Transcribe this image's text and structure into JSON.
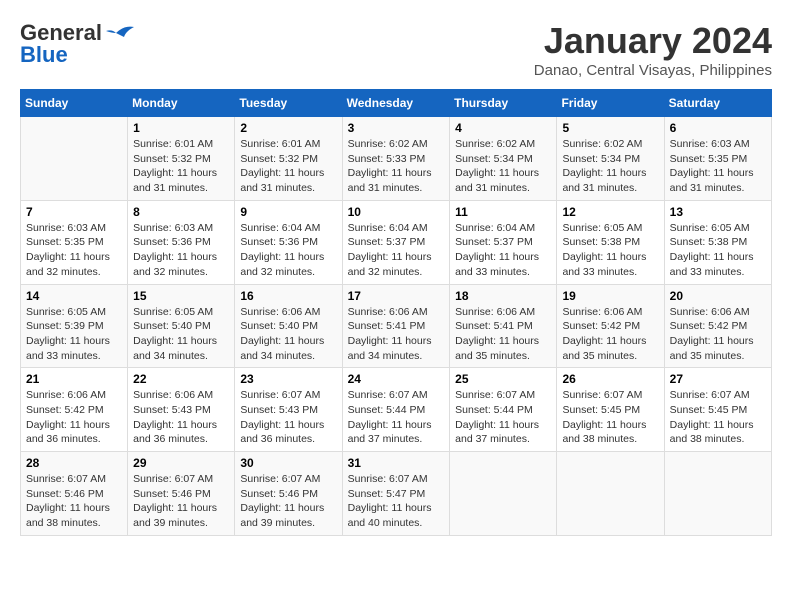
{
  "header": {
    "logo_general": "General",
    "logo_blue": "Blue",
    "month_title": "January 2024",
    "location": "Danao, Central Visayas, Philippines"
  },
  "days_of_week": [
    "Sunday",
    "Monday",
    "Tuesday",
    "Wednesday",
    "Thursday",
    "Friday",
    "Saturday"
  ],
  "weeks": [
    [
      {
        "day": "",
        "sunrise": "",
        "sunset": "",
        "daylight": ""
      },
      {
        "day": "1",
        "sunrise": "Sunrise: 6:01 AM",
        "sunset": "Sunset: 5:32 PM",
        "daylight": "Daylight: 11 hours and 31 minutes."
      },
      {
        "day": "2",
        "sunrise": "Sunrise: 6:01 AM",
        "sunset": "Sunset: 5:32 PM",
        "daylight": "Daylight: 11 hours and 31 minutes."
      },
      {
        "day": "3",
        "sunrise": "Sunrise: 6:02 AM",
        "sunset": "Sunset: 5:33 PM",
        "daylight": "Daylight: 11 hours and 31 minutes."
      },
      {
        "day": "4",
        "sunrise": "Sunrise: 6:02 AM",
        "sunset": "Sunset: 5:34 PM",
        "daylight": "Daylight: 11 hours and 31 minutes."
      },
      {
        "day": "5",
        "sunrise": "Sunrise: 6:02 AM",
        "sunset": "Sunset: 5:34 PM",
        "daylight": "Daylight: 11 hours and 31 minutes."
      },
      {
        "day": "6",
        "sunrise": "Sunrise: 6:03 AM",
        "sunset": "Sunset: 5:35 PM",
        "daylight": "Daylight: 11 hours and 31 minutes."
      }
    ],
    [
      {
        "day": "7",
        "sunrise": "Sunrise: 6:03 AM",
        "sunset": "Sunset: 5:35 PM",
        "daylight": "Daylight: 11 hours and 32 minutes."
      },
      {
        "day": "8",
        "sunrise": "Sunrise: 6:03 AM",
        "sunset": "Sunset: 5:36 PM",
        "daylight": "Daylight: 11 hours and 32 minutes."
      },
      {
        "day": "9",
        "sunrise": "Sunrise: 6:04 AM",
        "sunset": "Sunset: 5:36 PM",
        "daylight": "Daylight: 11 hours and 32 minutes."
      },
      {
        "day": "10",
        "sunrise": "Sunrise: 6:04 AM",
        "sunset": "Sunset: 5:37 PM",
        "daylight": "Daylight: 11 hours and 32 minutes."
      },
      {
        "day": "11",
        "sunrise": "Sunrise: 6:04 AM",
        "sunset": "Sunset: 5:37 PM",
        "daylight": "Daylight: 11 hours and 33 minutes."
      },
      {
        "day": "12",
        "sunrise": "Sunrise: 6:05 AM",
        "sunset": "Sunset: 5:38 PM",
        "daylight": "Daylight: 11 hours and 33 minutes."
      },
      {
        "day": "13",
        "sunrise": "Sunrise: 6:05 AM",
        "sunset": "Sunset: 5:38 PM",
        "daylight": "Daylight: 11 hours and 33 minutes."
      }
    ],
    [
      {
        "day": "14",
        "sunrise": "Sunrise: 6:05 AM",
        "sunset": "Sunset: 5:39 PM",
        "daylight": "Daylight: 11 hours and 33 minutes."
      },
      {
        "day": "15",
        "sunrise": "Sunrise: 6:05 AM",
        "sunset": "Sunset: 5:40 PM",
        "daylight": "Daylight: 11 hours and 34 minutes."
      },
      {
        "day": "16",
        "sunrise": "Sunrise: 6:06 AM",
        "sunset": "Sunset: 5:40 PM",
        "daylight": "Daylight: 11 hours and 34 minutes."
      },
      {
        "day": "17",
        "sunrise": "Sunrise: 6:06 AM",
        "sunset": "Sunset: 5:41 PM",
        "daylight": "Daylight: 11 hours and 34 minutes."
      },
      {
        "day": "18",
        "sunrise": "Sunrise: 6:06 AM",
        "sunset": "Sunset: 5:41 PM",
        "daylight": "Daylight: 11 hours and 35 minutes."
      },
      {
        "day": "19",
        "sunrise": "Sunrise: 6:06 AM",
        "sunset": "Sunset: 5:42 PM",
        "daylight": "Daylight: 11 hours and 35 minutes."
      },
      {
        "day": "20",
        "sunrise": "Sunrise: 6:06 AM",
        "sunset": "Sunset: 5:42 PM",
        "daylight": "Daylight: 11 hours and 35 minutes."
      }
    ],
    [
      {
        "day": "21",
        "sunrise": "Sunrise: 6:06 AM",
        "sunset": "Sunset: 5:42 PM",
        "daylight": "Daylight: 11 hours and 36 minutes."
      },
      {
        "day": "22",
        "sunrise": "Sunrise: 6:06 AM",
        "sunset": "Sunset: 5:43 PM",
        "daylight": "Daylight: 11 hours and 36 minutes."
      },
      {
        "day": "23",
        "sunrise": "Sunrise: 6:07 AM",
        "sunset": "Sunset: 5:43 PM",
        "daylight": "Daylight: 11 hours and 36 minutes."
      },
      {
        "day": "24",
        "sunrise": "Sunrise: 6:07 AM",
        "sunset": "Sunset: 5:44 PM",
        "daylight": "Daylight: 11 hours and 37 minutes."
      },
      {
        "day": "25",
        "sunrise": "Sunrise: 6:07 AM",
        "sunset": "Sunset: 5:44 PM",
        "daylight": "Daylight: 11 hours and 37 minutes."
      },
      {
        "day": "26",
        "sunrise": "Sunrise: 6:07 AM",
        "sunset": "Sunset: 5:45 PM",
        "daylight": "Daylight: 11 hours and 38 minutes."
      },
      {
        "day": "27",
        "sunrise": "Sunrise: 6:07 AM",
        "sunset": "Sunset: 5:45 PM",
        "daylight": "Daylight: 11 hours and 38 minutes."
      }
    ],
    [
      {
        "day": "28",
        "sunrise": "Sunrise: 6:07 AM",
        "sunset": "Sunset: 5:46 PM",
        "daylight": "Daylight: 11 hours and 38 minutes."
      },
      {
        "day": "29",
        "sunrise": "Sunrise: 6:07 AM",
        "sunset": "Sunset: 5:46 PM",
        "daylight": "Daylight: 11 hours and 39 minutes."
      },
      {
        "day": "30",
        "sunrise": "Sunrise: 6:07 AM",
        "sunset": "Sunset: 5:46 PM",
        "daylight": "Daylight: 11 hours and 39 minutes."
      },
      {
        "day": "31",
        "sunrise": "Sunrise: 6:07 AM",
        "sunset": "Sunset: 5:47 PM",
        "daylight": "Daylight: 11 hours and 40 minutes."
      },
      {
        "day": "",
        "sunrise": "",
        "sunset": "",
        "daylight": ""
      },
      {
        "day": "",
        "sunrise": "",
        "sunset": "",
        "daylight": ""
      },
      {
        "day": "",
        "sunrise": "",
        "sunset": "",
        "daylight": ""
      }
    ]
  ]
}
